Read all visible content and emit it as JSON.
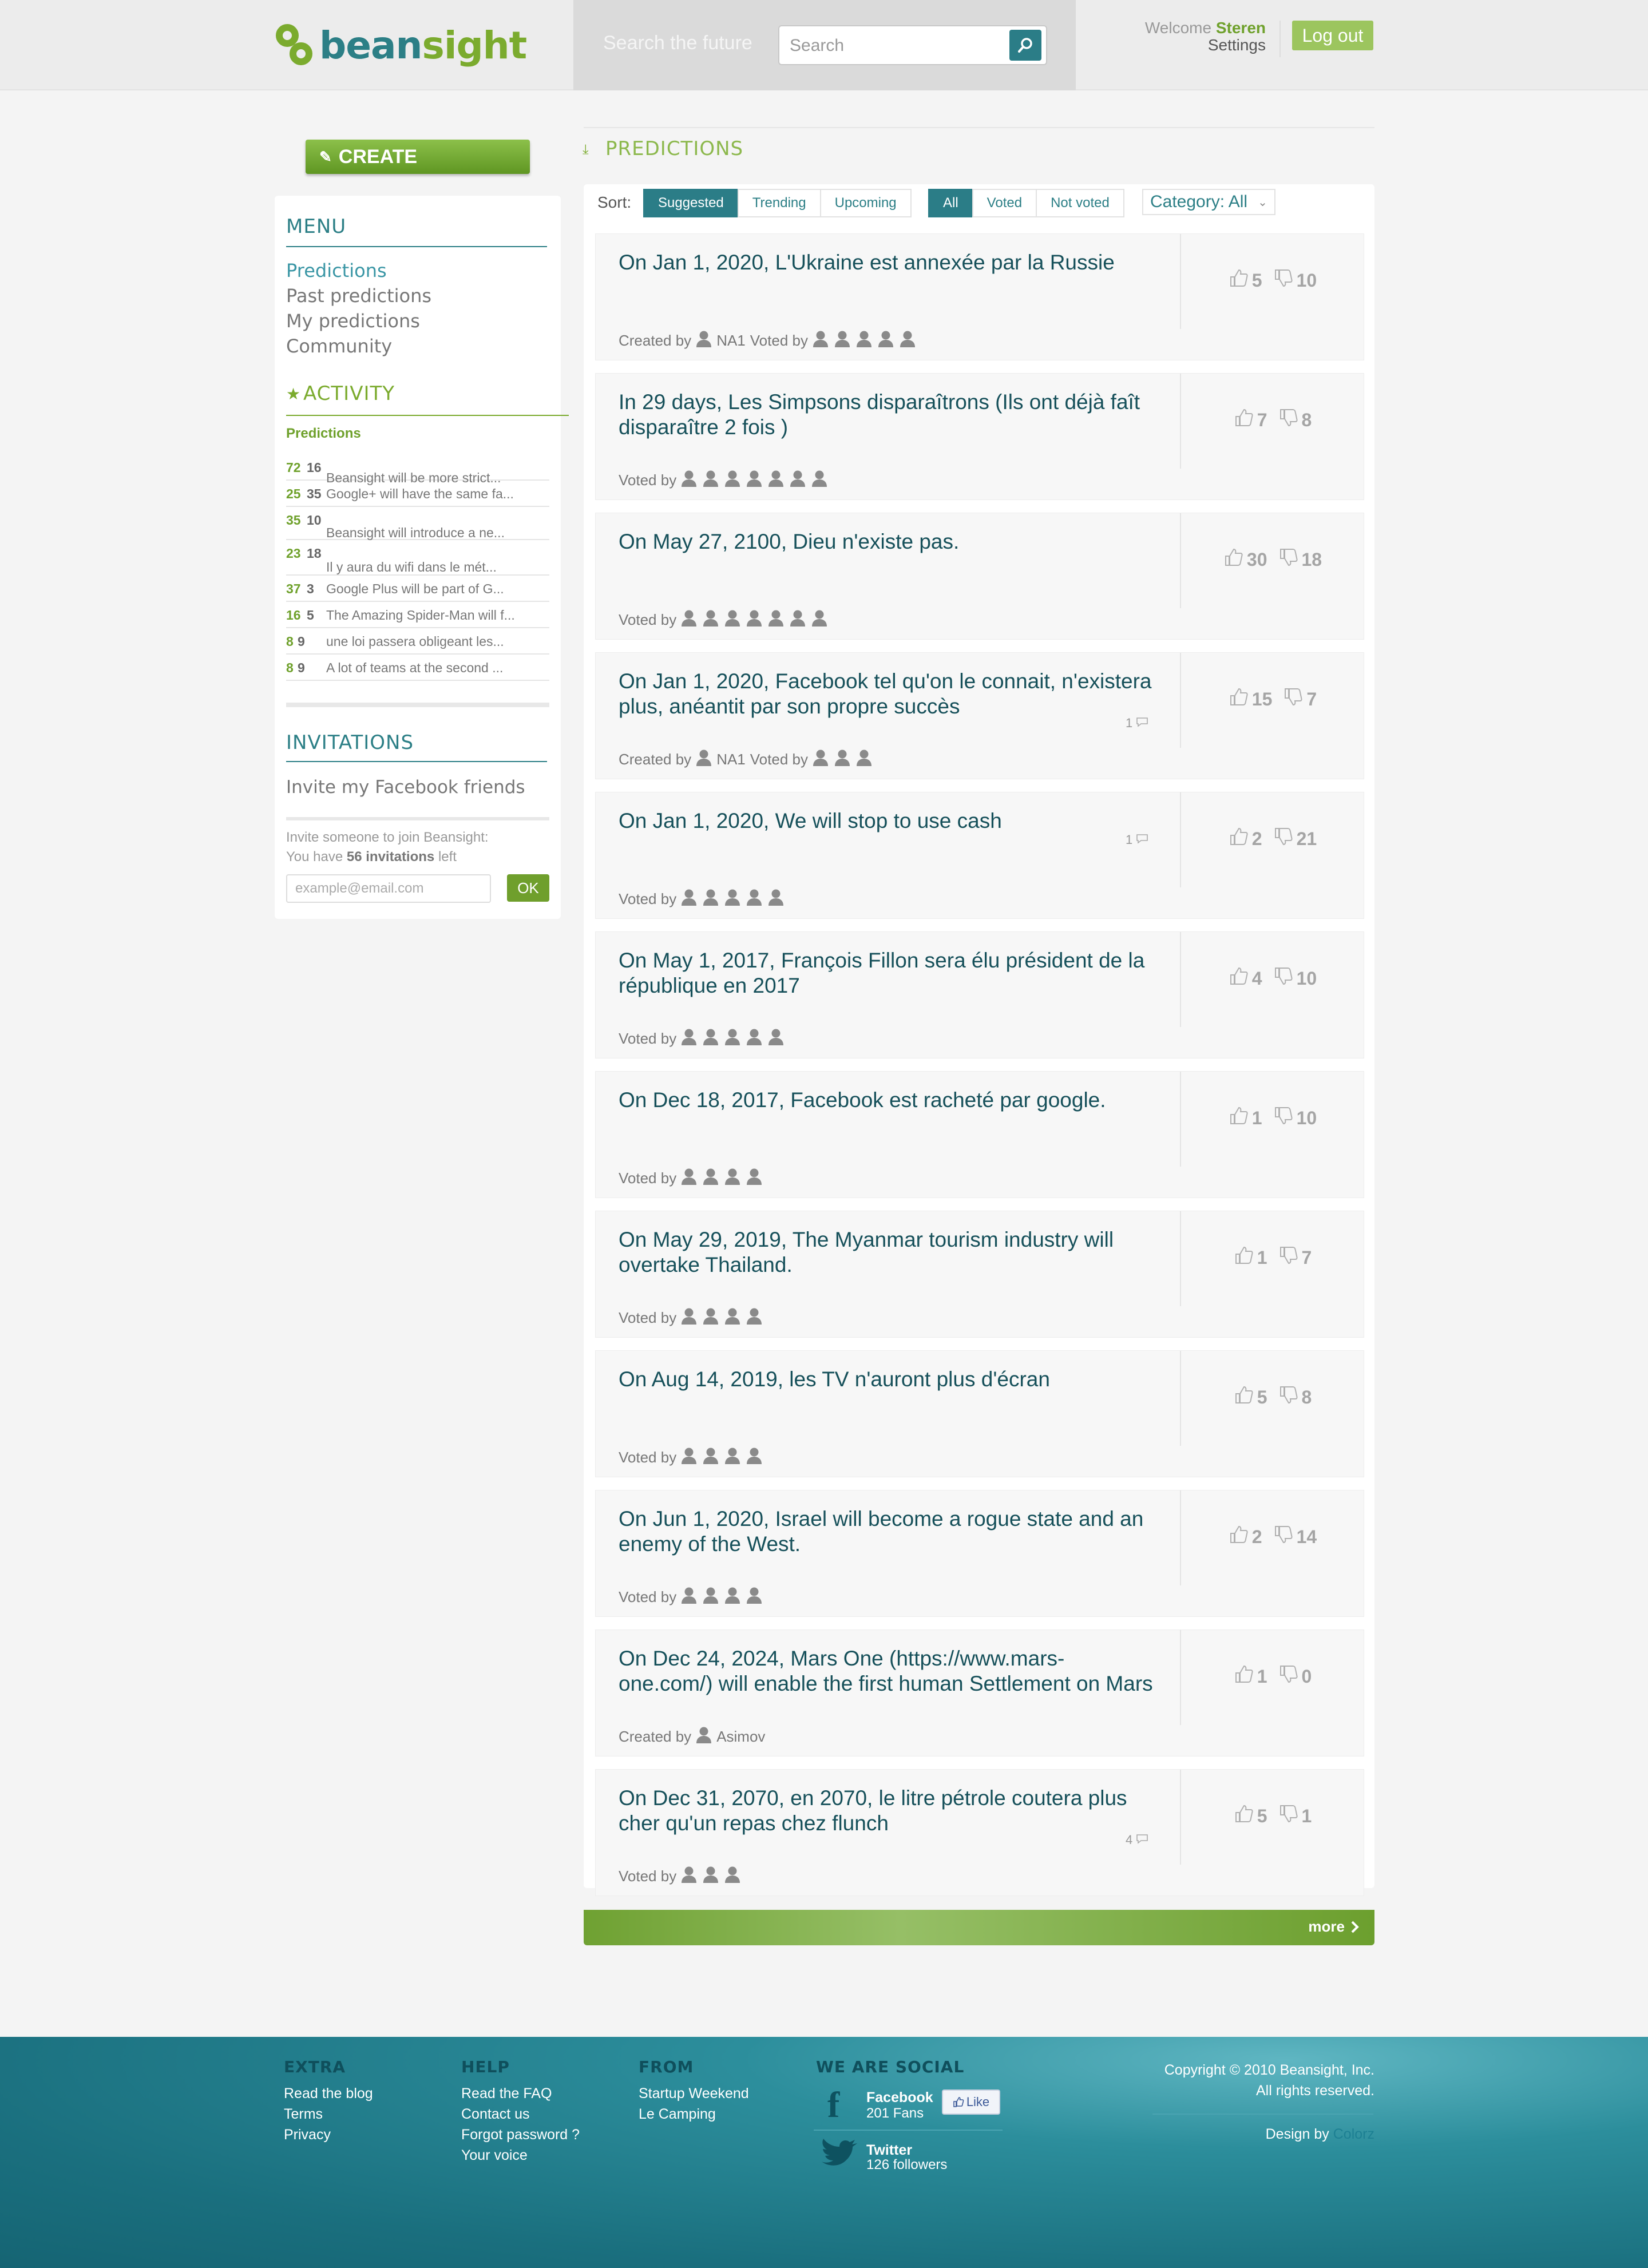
{
  "header": {
    "logo": {
      "part1": "bean",
      "part2": "sight"
    },
    "search": {
      "tagline": "Search the future",
      "placeholder": "Search"
    },
    "welcome_prefix": "Welcome",
    "username": "Steren",
    "settings": "Settings",
    "logout": "Log out"
  },
  "sidebar": {
    "create": "CREATE",
    "menu_title": "MENU",
    "menu_items": [
      "Predictions",
      "Past predictions",
      "My predictions",
      "Community"
    ],
    "activity_title": "ACTIVITY",
    "activity_subtitle": "Predictions",
    "activity": [
      {
        "yes": "72",
        "no": "16",
        "text": "Beansight will be more strict..."
      },
      {
        "yes": "25",
        "no": "35",
        "text": "Google+ will have the same fa..."
      },
      {
        "yes": "35",
        "no": "10",
        "text": "Beansight will introduce a ne..."
      },
      {
        "yes": "23",
        "no": "18",
        "text": "Il y aura du wifi dans le mét..."
      },
      {
        "yes": "37",
        "no": "3",
        "text": "Google Plus will be part of G..."
      },
      {
        "yes": "16",
        "no": "5",
        "text": "The Amazing Spider-Man will f..."
      },
      {
        "yes": "8",
        "no": "9",
        "text": "une loi passera obligeant les..."
      },
      {
        "yes": "8",
        "no": "9",
        "text": "A lot of teams at the second ..."
      }
    ],
    "invitations_title": "INVITATIONS",
    "invite_facebook": "Invite my Facebook friends",
    "invite_text": "Invite someone to join Beansight:",
    "invite_count_prefix": "You have",
    "invite_count": "56 invitations",
    "invite_count_suffix": "left",
    "email_placeholder": "example@email.com",
    "ok": "OK"
  },
  "main": {
    "title": "PREDICTIONS",
    "sort_label": "Sort:",
    "sort_options": [
      "Suggested",
      "Trending",
      "Upcoming"
    ],
    "filter_options": [
      "All",
      "Voted",
      "Not voted"
    ],
    "category": "Category: All",
    "labels": {
      "created_by": "Created by",
      "voted_by": "Voted by"
    },
    "predictions": [
      {
        "title": "On Jan 1, 2020, L'Ukraine est annexée par la Russie",
        "up": "5",
        "down": "10",
        "creator": "NA1",
        "voters": 5,
        "comments": ""
      },
      {
        "title": "In 29 days, Les Simpsons disparaîtrons (Ils ont déjà faît disparaître 2 fois )",
        "up": "7",
        "down": "8",
        "creator": "",
        "voters": 7,
        "comments": ""
      },
      {
        "title": "On May 27, 2100, Dieu n'existe pas.",
        "up": "30",
        "down": "18",
        "creator": "",
        "voters": 7,
        "comments": ""
      },
      {
        "title": "On Jan 1, 2020, Facebook tel qu'on le connait, n'existera plus, anéantit par son propre succès",
        "up": "15",
        "down": "7",
        "creator": "NA1",
        "voters": 3,
        "comments": "1"
      },
      {
        "title": "On Jan 1, 2020, We will stop to use cash",
        "up": "2",
        "down": "21",
        "creator": "",
        "voters": 5,
        "comments": "1"
      },
      {
        "title": "On May 1, 2017, François Fillon sera élu président de la république en 2017",
        "up": "4",
        "down": "10",
        "creator": "",
        "voters": 5,
        "comments": ""
      },
      {
        "title": "On Dec 18, 2017, Facebook est racheté par google.",
        "up": "1",
        "down": "10",
        "creator": "",
        "voters": 4,
        "comments": ""
      },
      {
        "title": "On May 29, 2019, The Myanmar tourism industry will overtake Thailand.",
        "up": "1",
        "down": "7",
        "creator": "",
        "voters": 4,
        "comments": ""
      },
      {
        "title": "On Aug 14, 2019, les TV n'auront plus d'écran",
        "up": "5",
        "down": "8",
        "creator": "",
        "voters": 4,
        "comments": ""
      },
      {
        "title": "On Jun 1, 2020, Israel will become a rogue state and an enemy of the West.",
        "up": "2",
        "down": "14",
        "creator": "",
        "voters": 4,
        "comments": ""
      },
      {
        "title": "On Dec 24, 2024, Mars One (https://www.mars-one.com/) will enable the first human Settlement on Mars",
        "up": "1",
        "down": "0",
        "creator": "Asimov",
        "voters": 0,
        "comments": ""
      },
      {
        "title": "On Dec 31, 2070, en 2070, le litre pétrole coutera plus cher qu'un repas chez flunch",
        "up": "5",
        "down": "1",
        "creator": "",
        "voters": 3,
        "comments": "4"
      }
    ],
    "more": "more"
  },
  "footer": {
    "extra": {
      "title": "EXTRA",
      "links": [
        "Read the blog",
        "Terms",
        "Privacy"
      ]
    },
    "help": {
      "title": "HELP",
      "links": [
        "Read the FAQ",
        "Contact us",
        "Forgot password ?",
        "Your voice"
      ]
    },
    "from": {
      "title": "FROM",
      "links": [
        "Startup Weekend",
        "Le Camping"
      ]
    },
    "social": {
      "title": "WE ARE SOCIAL",
      "facebook": {
        "name": "Facebook",
        "count": "201 Fans",
        "like": "Like"
      },
      "twitter": {
        "name": "Twitter",
        "count": "126 followers"
      }
    },
    "copyright_line1": "Copyright © 2010 Beansight, Inc.",
    "copyright_line2": "All rights reserved.",
    "design_by": "Design by",
    "designer": "Colorz"
  },
  "colors": {
    "teal": "#2b7d87",
    "green": "#7bab2e",
    "background": "#f4f4f4"
  }
}
